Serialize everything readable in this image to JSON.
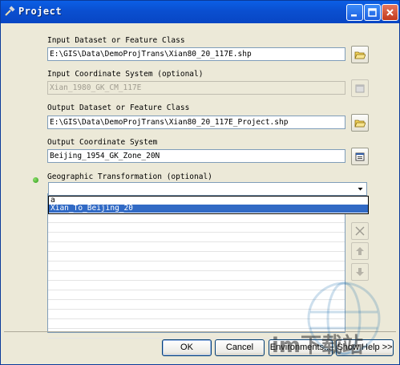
{
  "window": {
    "title": "Project",
    "controls": [
      "minimize-icon",
      "maximize-icon",
      "close-icon"
    ]
  },
  "fields": {
    "input_dataset": {
      "label": "Input Dataset or Feature Class",
      "value": "E:\\GIS\\Data\\DemoProjTrans\\Xian80_20_117E.shp"
    },
    "input_cs": {
      "label": "Input Coordinate System (optional)",
      "value": "Xian_1980_GK_CM_117E"
    },
    "output_dataset": {
      "label": "Output Dataset or Feature Class",
      "value": "E:\\GIS\\Data\\DemoProjTrans\\Xian80_20_117E_Project.shp"
    },
    "output_cs": {
      "label": "Output Coordinate System",
      "value": "Beijing_1954_GK_Zone_20N"
    },
    "geo_transform": {
      "label": "Geographic Transformation (optional)",
      "value": "",
      "options": [
        "a",
        "Xian_To_Beijing_20"
      ],
      "selected": "Xian_To_Beijing_20"
    }
  },
  "buttons": {
    "ok": "OK",
    "cancel": "Cancel",
    "environments": "Environments...",
    "show_help": "Show Help >>"
  },
  "watermark": {
    "text": "im下载站"
  },
  "colors": {
    "titlebar": "#0a4fd0",
    "selection": "#316ac5",
    "dialog_bg": "#ece9d8"
  }
}
